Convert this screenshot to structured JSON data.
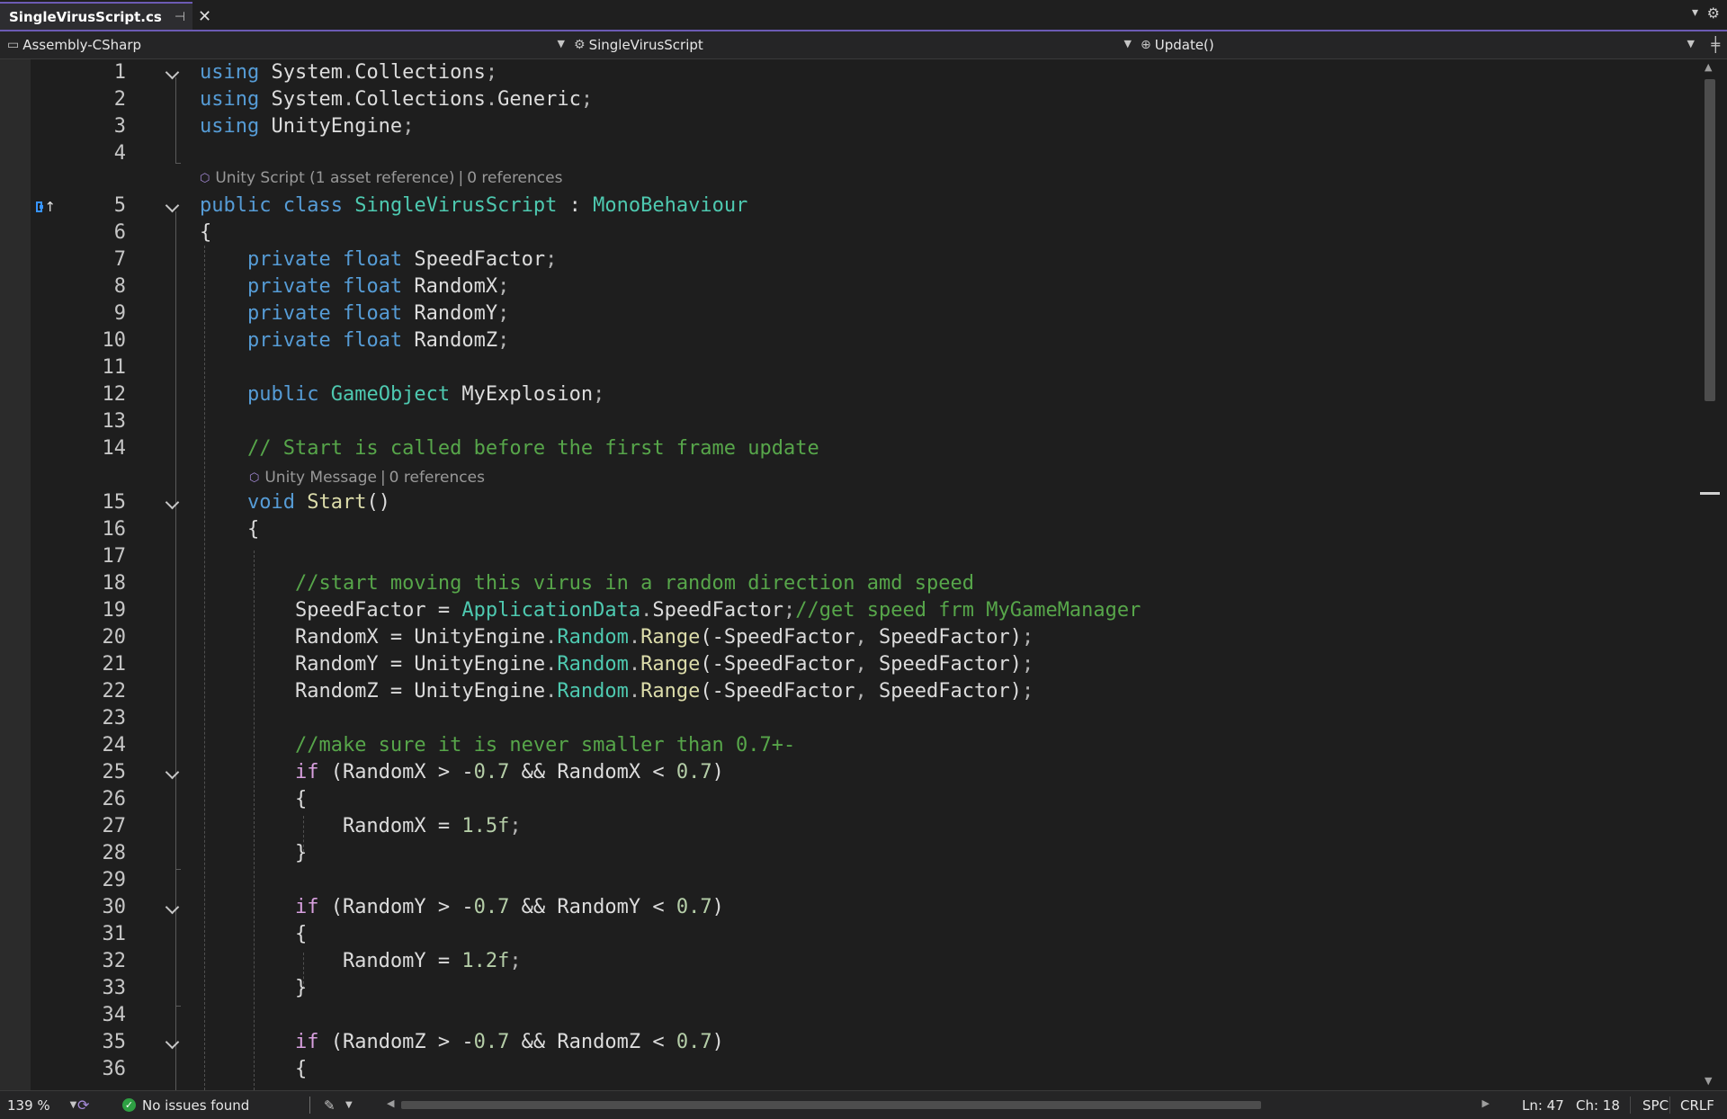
{
  "tab": {
    "title": "SingleVirusScript.cs",
    "pin_glyph": "⊣",
    "close_glyph": "✕"
  },
  "nav": {
    "project": "Assembly-CSharp",
    "class": "SingleVirusScript",
    "member": "Update()"
  },
  "codelens": [
    {
      "icon": "unity-icon",
      "text": "Unity Script (1 asset reference)",
      "refs": "0 references"
    },
    {
      "icon": "unity-icon",
      "text": "Unity Message",
      "refs": "0 references"
    }
  ],
  "lines": [
    {
      "n": "1",
      "text": "using System.Collections;"
    },
    {
      "n": "2",
      "text": "using System.Collections.Generic;"
    },
    {
      "n": "3",
      "text": "using UnityEngine;"
    },
    {
      "n": "4",
      "text": ""
    },
    {
      "n": "5",
      "text": "public class SingleVirusScript : MonoBehaviour"
    },
    {
      "n": "6",
      "text": "{"
    },
    {
      "n": "7",
      "text": "    private float SpeedFactor;"
    },
    {
      "n": "8",
      "text": "    private float RandomX;"
    },
    {
      "n": "9",
      "text": "    private float RandomY;"
    },
    {
      "n": "10",
      "text": "    private float RandomZ;"
    },
    {
      "n": "11",
      "text": ""
    },
    {
      "n": "12",
      "text": "    public GameObject MyExplosion;"
    },
    {
      "n": "13",
      "text": ""
    },
    {
      "n": "14",
      "text": "    // Start is called before the first frame update"
    },
    {
      "n": "15",
      "text": "    void Start()"
    },
    {
      "n": "16",
      "text": "    {"
    },
    {
      "n": "17",
      "text": ""
    },
    {
      "n": "18",
      "text": "        //start moving this virus in a random direction amd speed"
    },
    {
      "n": "19",
      "text": "        SpeedFactor = ApplicationData.SpeedFactor;//get speed frm MyGameManager"
    },
    {
      "n": "20",
      "text": "        RandomX = UnityEngine.Random.Range(-SpeedFactor, SpeedFactor);"
    },
    {
      "n": "21",
      "text": "        RandomY = UnityEngine.Random.Range(-SpeedFactor, SpeedFactor);"
    },
    {
      "n": "22",
      "text": "        RandomZ = UnityEngine.Random.Range(-SpeedFactor, SpeedFactor);"
    },
    {
      "n": "23",
      "text": ""
    },
    {
      "n": "24",
      "text": "        //make sure it is never smaller than 0.7+-"
    },
    {
      "n": "25",
      "text": "        if (RandomX > -0.7 && RandomX < 0.7)"
    },
    {
      "n": "26",
      "text": "        {"
    },
    {
      "n": "27",
      "text": "            RandomX = 1.5f;"
    },
    {
      "n": "28",
      "text": "        }"
    },
    {
      "n": "29",
      "text": ""
    },
    {
      "n": "30",
      "text": "        if (RandomY > -0.7 && RandomY < 0.7)"
    },
    {
      "n": "31",
      "text": "        {"
    },
    {
      "n": "32",
      "text": "            RandomY = 1.2f;"
    },
    {
      "n": "33",
      "text": "        }"
    },
    {
      "n": "34",
      "text": ""
    },
    {
      "n": "35",
      "text": "        if (RandomZ > -0.7 && RandomZ < 0.7)"
    },
    {
      "n": "36",
      "text": "        {"
    }
  ],
  "status": {
    "zoom": "139 %",
    "issues": "No issues found",
    "line": "Ln: 47",
    "col": "Ch: 18",
    "encoding": "SPC",
    "eol": "CRLF"
  },
  "colors": {
    "keyword": "#569cd6",
    "control": "#d8a0df",
    "type": "#4ec9b0",
    "method": "#dcdcaa",
    "comment": "#57a64a",
    "number": "#b5cea8",
    "accent": "#6c5bb4"
  }
}
